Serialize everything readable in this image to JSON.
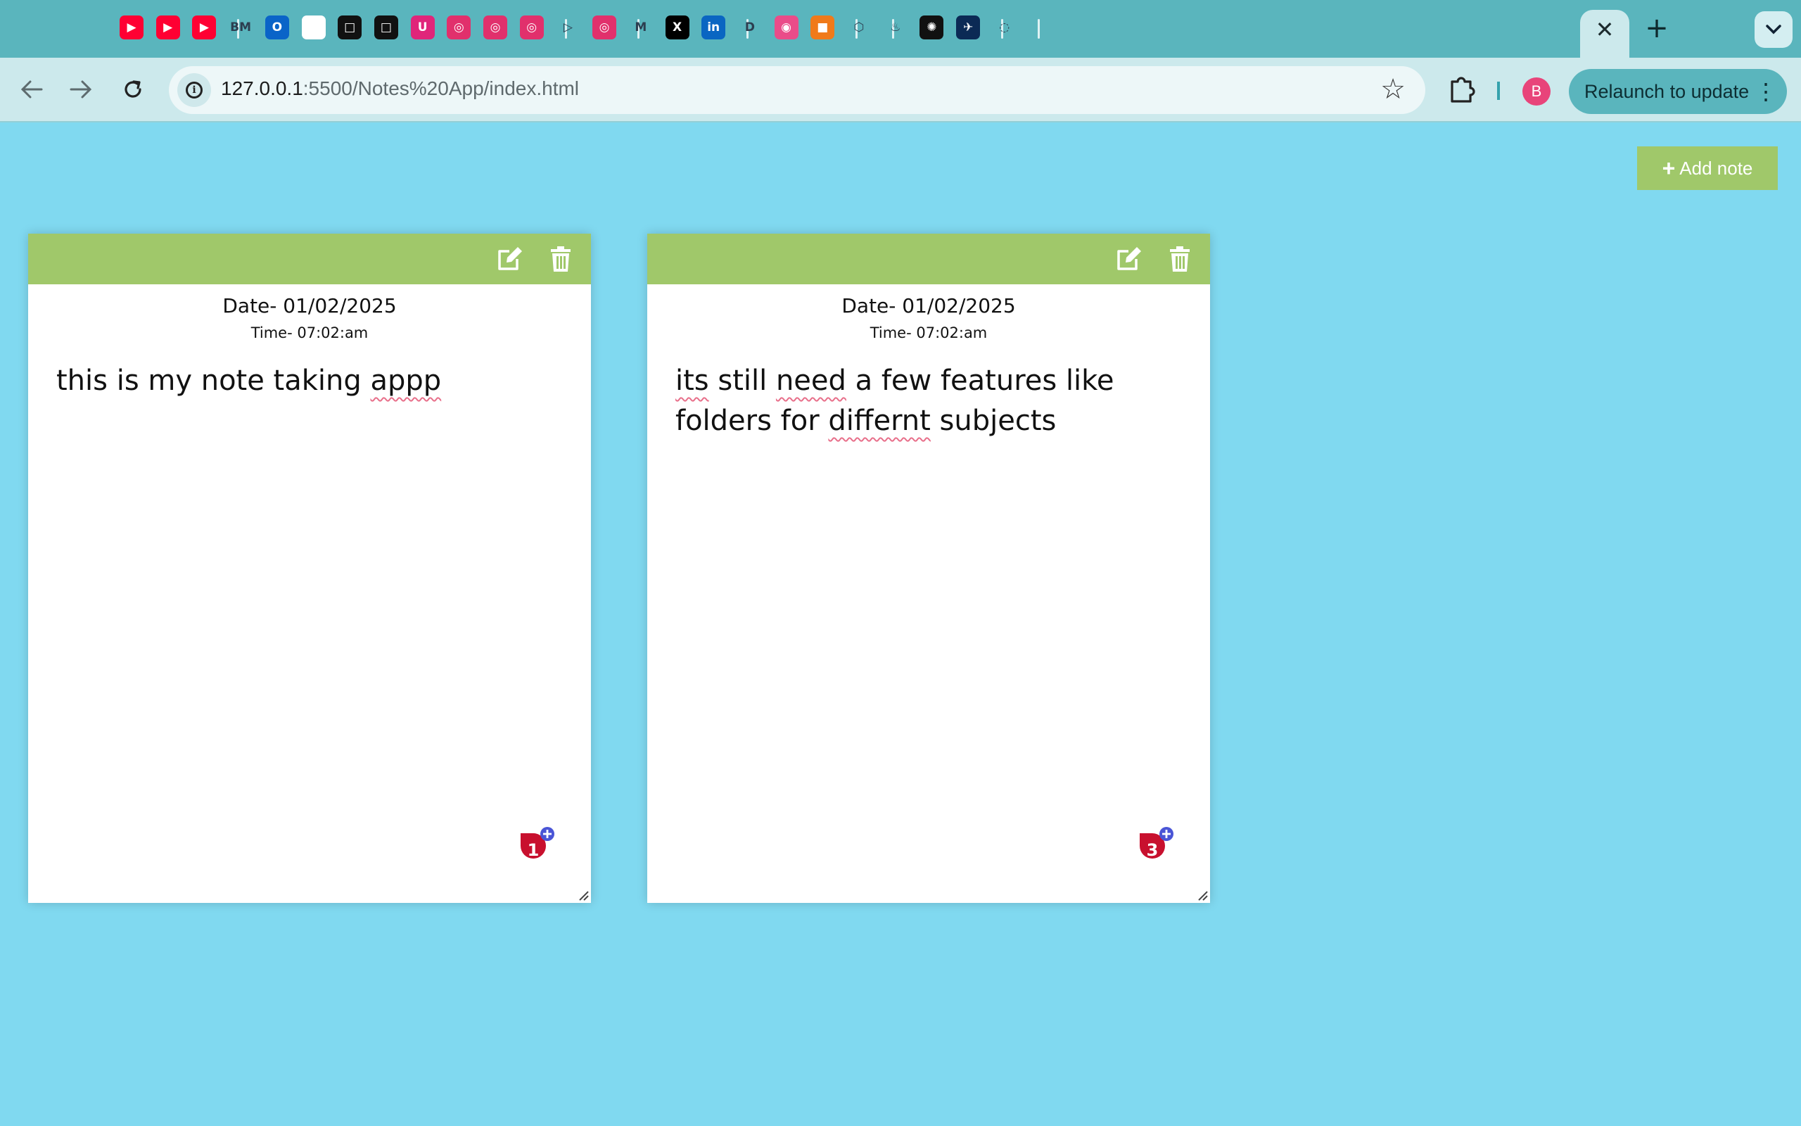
{
  "browser": {
    "tab_favicons": [
      {
        "name": "youtube-favicon-icon",
        "color": "#ff0033",
        "glyph": "▶"
      },
      {
        "name": "youtube-favicon-icon",
        "color": "#ff0033",
        "glyph": "▶"
      },
      {
        "name": "youtube-favicon-icon",
        "color": "#ff0033",
        "glyph": "▶"
      },
      {
        "name": "bm-favicon-icon",
        "color": "#5ab5bd",
        "glyph": "BM"
      },
      {
        "name": "outlook-favicon-icon",
        "color": "#0a64c8",
        "glyph": "O"
      },
      {
        "name": "white-doc-favicon-icon",
        "color": "#ffffff",
        "glyph": ""
      },
      {
        "name": "black-square-favicon-icon",
        "color": "#111111",
        "glyph": "□"
      },
      {
        "name": "black-square-favicon-icon",
        "color": "#111111",
        "glyph": "□"
      },
      {
        "name": "u-favicon-icon",
        "color": "#e0257a",
        "glyph": "U"
      },
      {
        "name": "instagram-favicon-icon",
        "color": "#e1306c",
        "glyph": "◎"
      },
      {
        "name": "instagram-favicon-icon",
        "color": "#e1306c",
        "glyph": "◎"
      },
      {
        "name": "instagram-favicon-icon",
        "color": "#e1306c",
        "glyph": "◎"
      },
      {
        "name": "play-outline-favicon-icon",
        "color": "#5ab5bd",
        "glyph": "▷"
      },
      {
        "name": "instagram-favicon-icon",
        "color": "#e1306c",
        "glyph": "◎"
      },
      {
        "name": "gmail-favicon-icon",
        "color": "#5ab5bd",
        "glyph": "M"
      },
      {
        "name": "x-favicon-icon",
        "color": "#000000",
        "glyph": "X"
      },
      {
        "name": "linkedin-favicon-icon",
        "color": "#0a66c2",
        "glyph": "in"
      },
      {
        "name": "d-favicon-icon",
        "color": "#5ab5bd",
        "glyph": "D"
      },
      {
        "name": "dribbble-favicon-icon",
        "color": "#ea4c89",
        "glyph": "◉"
      },
      {
        "name": "box-favicon-icon",
        "color": "#f07a1a",
        "glyph": "■"
      },
      {
        "name": "cube-favicon-icon",
        "color": "#5ab5bd",
        "glyph": "⬡"
      },
      {
        "name": "flame-favicon-icon",
        "color": "#5ab5bd",
        "glyph": "♨"
      },
      {
        "name": "chatgpt-favicon-icon",
        "color": "#111111",
        "glyph": "✺"
      },
      {
        "name": "airline-favicon-icon",
        "color": "#0b2a55",
        "glyph": "✈"
      },
      {
        "name": "loading-favicon-icon",
        "color": "#5ab5bd",
        "glyph": "◌"
      }
    ],
    "active_tab_close": "✕",
    "new_tab": "+",
    "tab_search": "⌄",
    "url_host": "127.0.0.1",
    "url_rest": ":5500/Notes%20App/index.html",
    "profile_initial": "B",
    "relaunch_label": "Relaunch to update"
  },
  "page": {
    "add_note_label": "Add note",
    "notes": [
      {
        "date": "Date- 01/02/2025",
        "time": "Time- 07:02:am",
        "text_segments": [
          {
            "t": "this is my note taking ",
            "spell": false
          },
          {
            "t": "appp",
            "spell": true
          }
        ],
        "badge_count": "1"
      },
      {
        "date": "Date- 01/02/2025",
        "time": "Time- 07:02:am",
        "text_segments": [
          {
            "t": "its",
            "spell": true
          },
          {
            "t": " still ",
            "spell": false
          },
          {
            "t": "need",
            "spell": true
          },
          {
            "t": " a few features like folders for ",
            "spell": false
          },
          {
            "t": "differnt",
            "spell": true
          },
          {
            "t": " subjects",
            "spell": false
          }
        ],
        "badge_count": "3"
      }
    ]
  },
  "colors": {
    "page_bg": "#80d9f0",
    "accent_green": "#a0c86a",
    "tab_strip": "#5ab5bd",
    "badge_red": "#c8102e",
    "badge_plus": "#4a55d6"
  }
}
